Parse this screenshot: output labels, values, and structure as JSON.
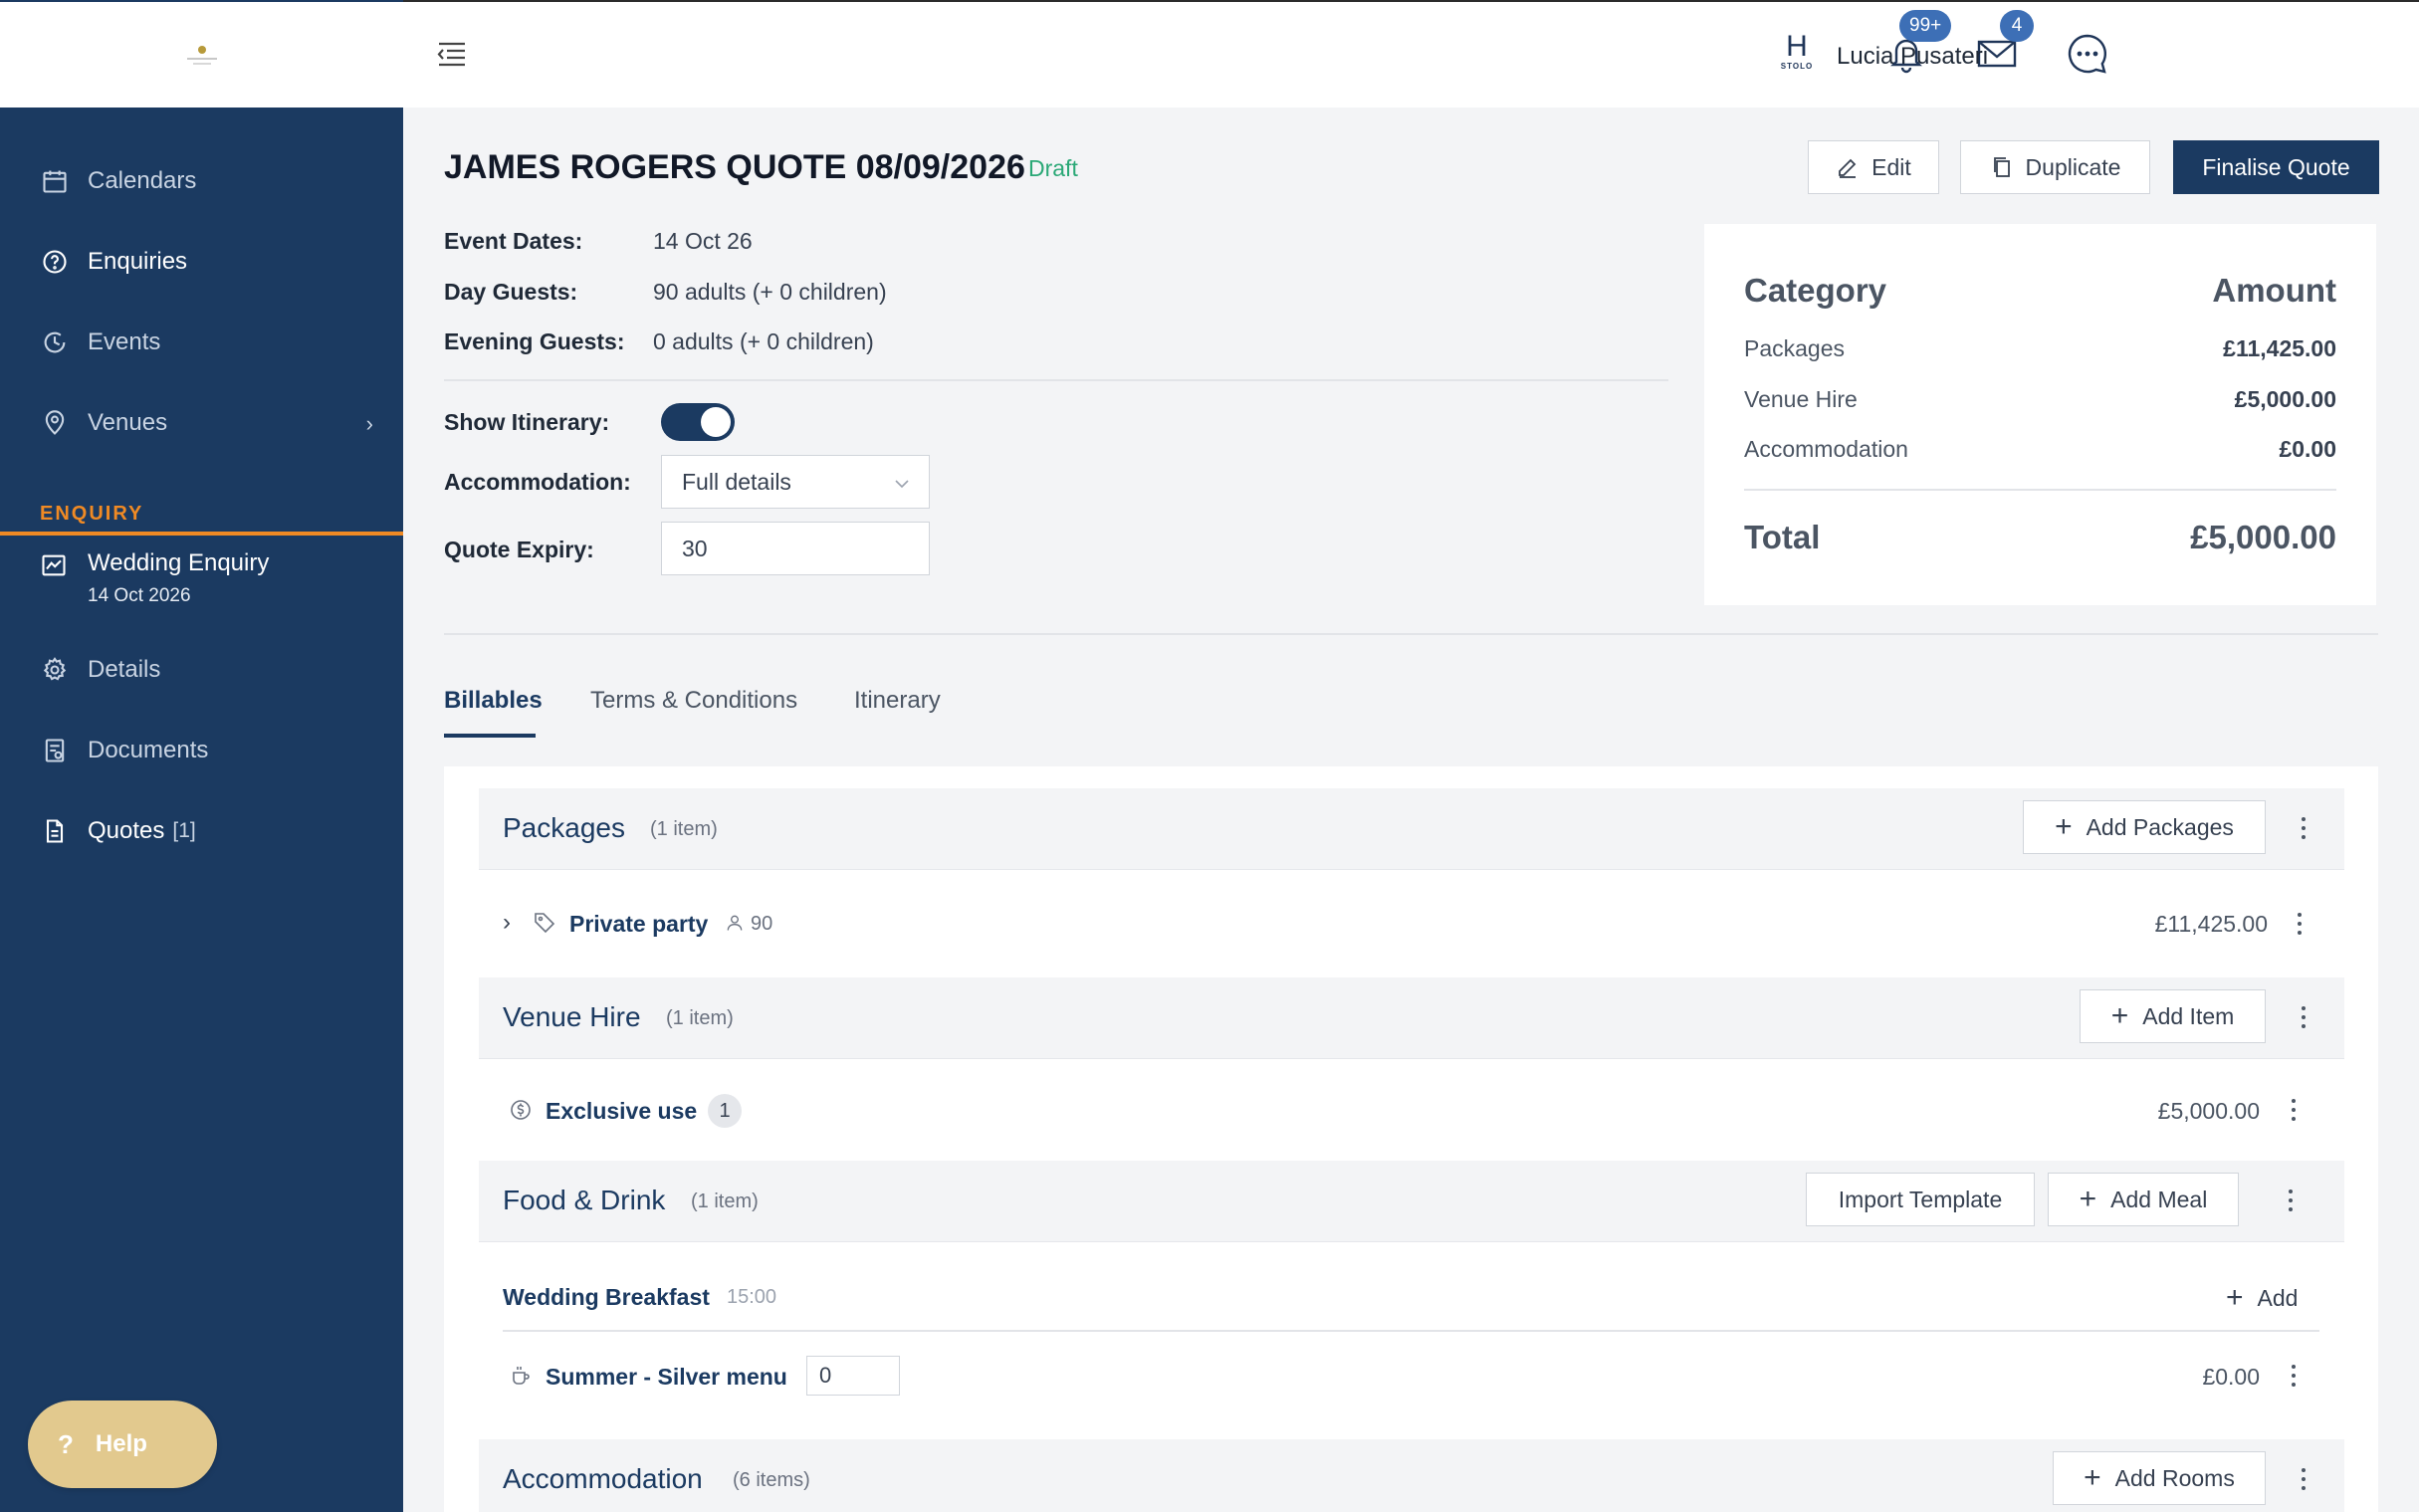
{
  "sidebar": {
    "nav": [
      {
        "label": "Calendars",
        "icon": "calendar-icon"
      },
      {
        "label": "Enquiries",
        "icon": "question-circle-icon"
      },
      {
        "label": "Events",
        "icon": "clock-icon"
      },
      {
        "label": "Venues",
        "icon": "location-pin-icon"
      }
    ],
    "section_label": "ENQUIRY",
    "enquiry": {
      "title": "Wedding Enquiry",
      "date": "14 Oct 2026"
    },
    "sub_nav": [
      {
        "label": "Details",
        "icon": "gear-icon"
      },
      {
        "label": "Documents",
        "icon": "documents-icon"
      },
      {
        "label": "Quotes",
        "count": "[1]",
        "icon": "file-icon"
      }
    ],
    "help_label": "Help"
  },
  "header": {
    "notifications_badge": "99+",
    "mail_badge": "4",
    "brand_letter": "H",
    "brand_text": "STOLO",
    "user_name": "Lucia Pusateri"
  },
  "quote": {
    "title": "JAMES ROGERS QUOTE 08/09/2026",
    "status": "Draft",
    "actions": {
      "edit": "Edit",
      "duplicate": "Duplicate",
      "finalise": "Finalise Quote"
    },
    "fields": {
      "event_dates_label": "Event Dates:",
      "event_dates": "14 Oct 26",
      "day_guests_label": "Day Guests:",
      "day_guests": "90 adults (+ 0 children)",
      "evening_guests_label": "Evening Guests:",
      "evening_guests": "0 adults (+ 0 children)",
      "show_itinerary_label": "Show Itinerary:",
      "show_itinerary": true,
      "accommodation_label": "Accommodation:",
      "accommodation": "Full details",
      "quote_expiry_label": "Quote Expiry:",
      "quote_expiry": "30"
    }
  },
  "summary": {
    "header_category": "Category",
    "header_amount": "Amount",
    "rows": [
      {
        "category": "Packages",
        "amount": "£11,425.00"
      },
      {
        "category": "Venue Hire",
        "amount": "£5,000.00"
      },
      {
        "category": "Accommodation",
        "amount": "£0.00"
      }
    ],
    "total_label": "Total",
    "total_amount": "£5,000.00"
  },
  "tabs": [
    {
      "label": "Billables",
      "active": true
    },
    {
      "label": "Terms & Conditions",
      "active": false
    },
    {
      "label": "Itinerary",
      "active": false
    }
  ],
  "billables": {
    "packages": {
      "title": "Packages",
      "count": "(1 item)",
      "add_label": "Add Packages",
      "item": {
        "name": "Private party",
        "guests": "90",
        "amount": "£11,425.00"
      }
    },
    "venue_hire": {
      "title": "Venue Hire",
      "count": "(1 item)",
      "add_label": "Add Item",
      "item": {
        "name": "Exclusive use",
        "qty": "1",
        "amount": "£5,000.00"
      }
    },
    "food_drink": {
      "title": "Food & Drink",
      "count": "(1 item)",
      "import_label": "Import Template",
      "add_label": "Add Meal",
      "meal": {
        "name": "Wedding Breakfast",
        "time": "15:00",
        "add_label": "Add"
      },
      "item": {
        "name": "Summer - Silver menu",
        "qty": "0",
        "amount": "£0.00"
      }
    },
    "accommodation": {
      "title": "Accommodation",
      "count": "(6 items)",
      "add_label": "Add Rooms"
    }
  }
}
